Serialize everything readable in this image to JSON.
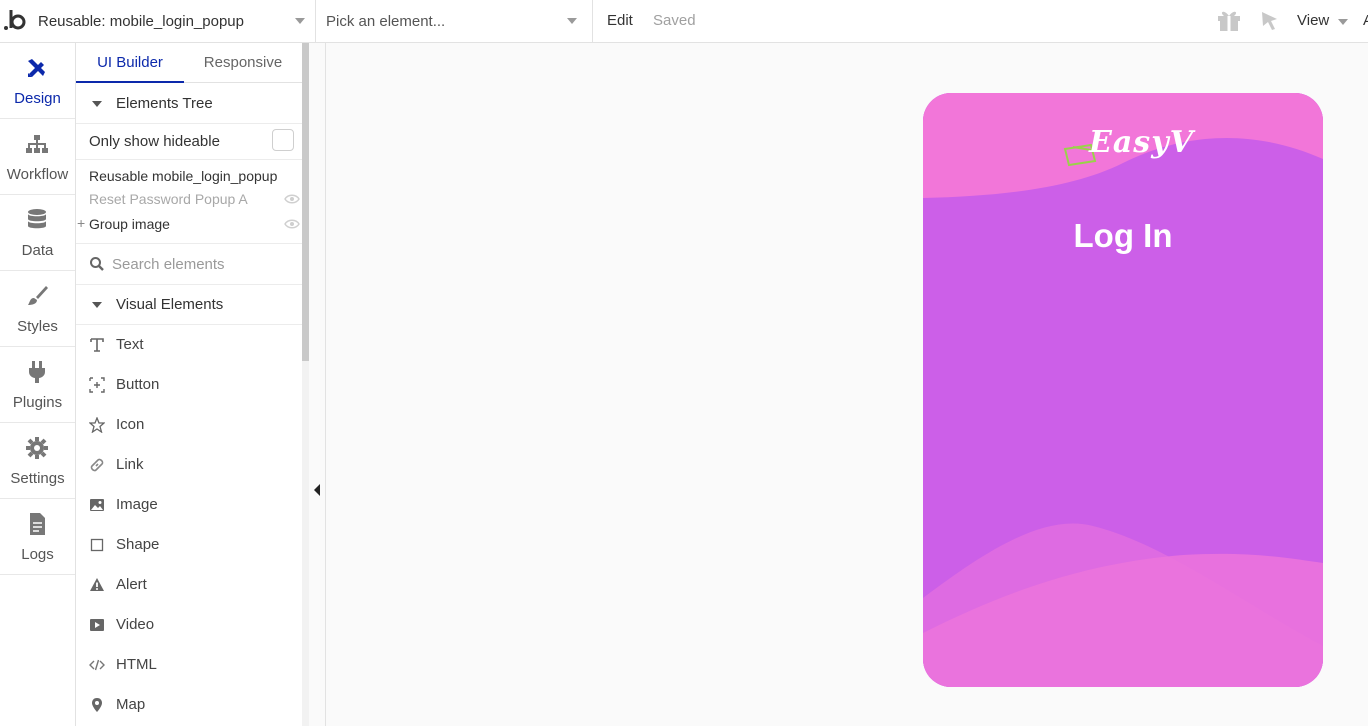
{
  "topbar": {
    "page_name": "Reusable: mobile_login_popup",
    "element_picker_placeholder": "Pick an element...",
    "edit_label": "Edit",
    "saved_label": "Saved",
    "view_label": "View",
    "extra_label": "A"
  },
  "rail": [
    {
      "label": "Design",
      "icon": "design-icon"
    },
    {
      "label": "Workflow",
      "icon": "workflow-icon"
    },
    {
      "label": "Data",
      "icon": "database-icon"
    },
    {
      "label": "Styles",
      "icon": "brush-icon"
    },
    {
      "label": "Plugins",
      "icon": "plug-icon"
    },
    {
      "label": "Settings",
      "icon": "gear-icon"
    },
    {
      "label": "Logs",
      "icon": "document-icon"
    }
  ],
  "panel": {
    "tabs": [
      "UI Builder",
      "Responsive"
    ],
    "elements_tree_title": "Elements Tree",
    "only_show_hideable": "Only show hideable",
    "tree": [
      "Reusable mobile_login_popup",
      "Reset Password Popup A",
      "Group image"
    ],
    "search_placeholder": "Search elements",
    "visual_elements_title": "Visual Elements",
    "visual_elements": [
      {
        "label": "Text",
        "icon": "text-icon"
      },
      {
        "label": "Button",
        "icon": "button-icon"
      },
      {
        "label": "Icon",
        "icon": "star-icon"
      },
      {
        "label": "Link",
        "icon": "link-icon"
      },
      {
        "label": "Image",
        "icon": "image-icon"
      },
      {
        "label": "Shape",
        "icon": "shape-icon"
      },
      {
        "label": "Alert",
        "icon": "alert-icon"
      },
      {
        "label": "Video",
        "icon": "video-icon"
      },
      {
        "label": "HTML",
        "icon": "code-icon"
      },
      {
        "label": "Map",
        "icon": "map-pin-icon"
      }
    ]
  },
  "preview": {
    "brand": "EasyV",
    "title": "Log In",
    "colors": {
      "background": "#cc5fe8",
      "wave_light": "#f276d9",
      "accent": "#0c29ab"
    }
  }
}
